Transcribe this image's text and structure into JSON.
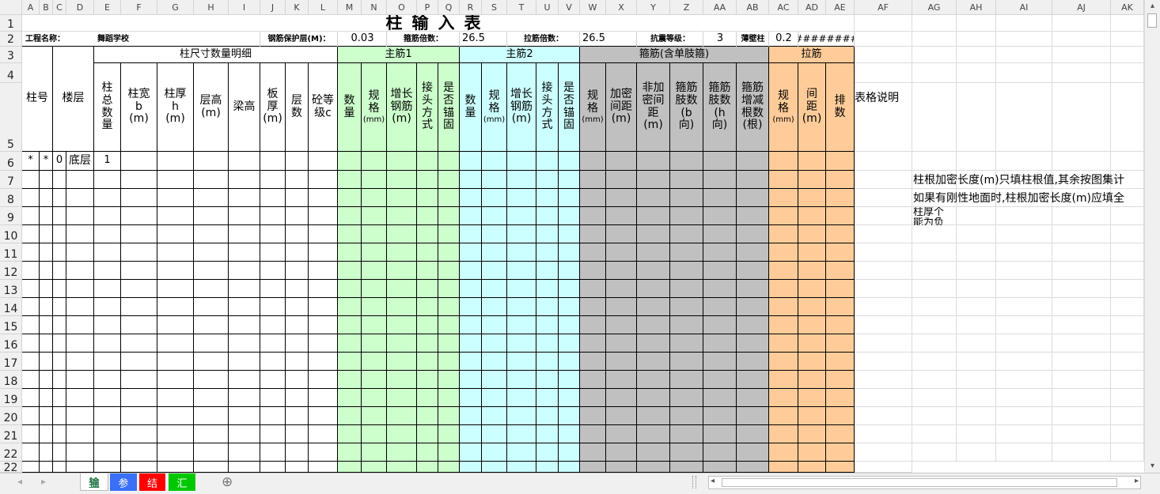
{
  "columns": [
    "A",
    "B",
    "C",
    "D",
    "E",
    "F",
    "G",
    "H",
    "I",
    "J",
    "K",
    "L",
    "M",
    "N",
    "O",
    "P",
    "Q",
    "R",
    "S",
    "T",
    "U",
    "V",
    "W",
    "X",
    "Y",
    "Z",
    "AA",
    "AB",
    "AC",
    "AD",
    "AE",
    "AF",
    "AG",
    "AH",
    "AI",
    "AJ",
    "AK"
  ],
  "rows": [
    "1",
    "2",
    "3",
    "4",
    "5",
    "6",
    "7",
    "8",
    "9",
    "10",
    "11",
    "12",
    "13",
    "14",
    "15",
    "16",
    "17",
    "18",
    "19",
    "20",
    "21",
    "22"
  ],
  "title": "柱输入表",
  "info": {
    "project_label": "工程名称：",
    "project_value": "舞蹈学校",
    "cover_label": "钢筋保护层(M)：",
    "cover_value": "0.03",
    "stirrup_mult_label": "箍筋倍数：",
    "stirrup_mult_value": "26.5",
    "tie_mult_label": "拉筋倍数：",
    "tie_mult_value": "26.5",
    "seismic_label": "抗震等级：",
    "seismic_value": "3",
    "thin_wall_label": "薄壁柱",
    "thin_wall_value": "0.2",
    "overflow_value": "########"
  },
  "groups": {
    "size": "柱尺寸数量明细",
    "main1": "主筋1",
    "main2": "主筋2",
    "stirrup": "箍筋(含单肢箍)",
    "tie": "拉筋"
  },
  "headers": {
    "col_id": "柱号",
    "floor": "楼层",
    "total_qty": "柱\n总\n数\n量",
    "width": "柱宽",
    "width_sub": "b\n(m)",
    "thick": "柱厚",
    "thick_sub": "h\n(m)",
    "story_h": "层高\n(m)",
    "beam_h": "梁高",
    "slab": "板\n厚\n(m)",
    "layers": "层\n数",
    "concrete": "砼等\n级c",
    "m1_qty": "数\n量",
    "m1_spec": "规\n格",
    "m1_spec_unit": "(mm)",
    "m1_extend": "增长\n钢筋\n(m)",
    "m1_joint": "接\n头\n方\n式",
    "m1_anchor": "是\n否\n锚\n固",
    "m2_qty": "数\n量",
    "m2_spec": "规\n格",
    "m2_spec_unit": "(mm)",
    "m2_extend": "增长\n钢筋\n(m)",
    "m2_joint": "接\n头\n方\n式",
    "m2_anchor": "是\n否\n锚\n固",
    "st_spec": "规\n格",
    "st_spec_unit": "(mm)",
    "st_dense": "加密\n间距\n(m)",
    "st_nondense": "非加\n密间\n距\n(m)",
    "st_legs_b": "箍筋\n肢数\n(b\n向)",
    "st_legs_h": "箍筋\n肢数\n(h\n向)",
    "st_adjust": "箍筋\n增减\n根数\n(根)",
    "tie_spec": "规\n格",
    "tie_spec_unit": "(mm)",
    "tie_spacing": "间\n距\n(m)",
    "tie_rows": "排\n数",
    "remark": "表格说明"
  },
  "row5": {
    "a": "*",
    "b": "*",
    "c": "0",
    "floor": "底层",
    "qty": "1"
  },
  "notes": [
    "柱根加密长度(m)只填柱根值,其余按图集计",
    "如果有刚性地面时,柱根加密长度(m)应填全",
    "柱厚个",
    "能为负"
  ],
  "sheet_tabs": [
    {
      "label": "输",
      "color": "#ffffff"
    },
    {
      "label": "参",
      "color": "#3a6ff7"
    },
    {
      "label": "结",
      "color": "#ff0000"
    },
    {
      "label": "汇",
      "color": "#00c800"
    }
  ],
  "colors": {
    "green": "#ccffcc",
    "cyan": "#ccffff",
    "gray": "#c0c0c0",
    "orange": "#ffcc99"
  },
  "nav": {
    "prev": "◂",
    "next": "▸",
    "add": "⊕",
    "scroll_left": "◂",
    "scroll_right": "▸",
    "scroll_up": "▴",
    "scroll_down": "▾"
  }
}
